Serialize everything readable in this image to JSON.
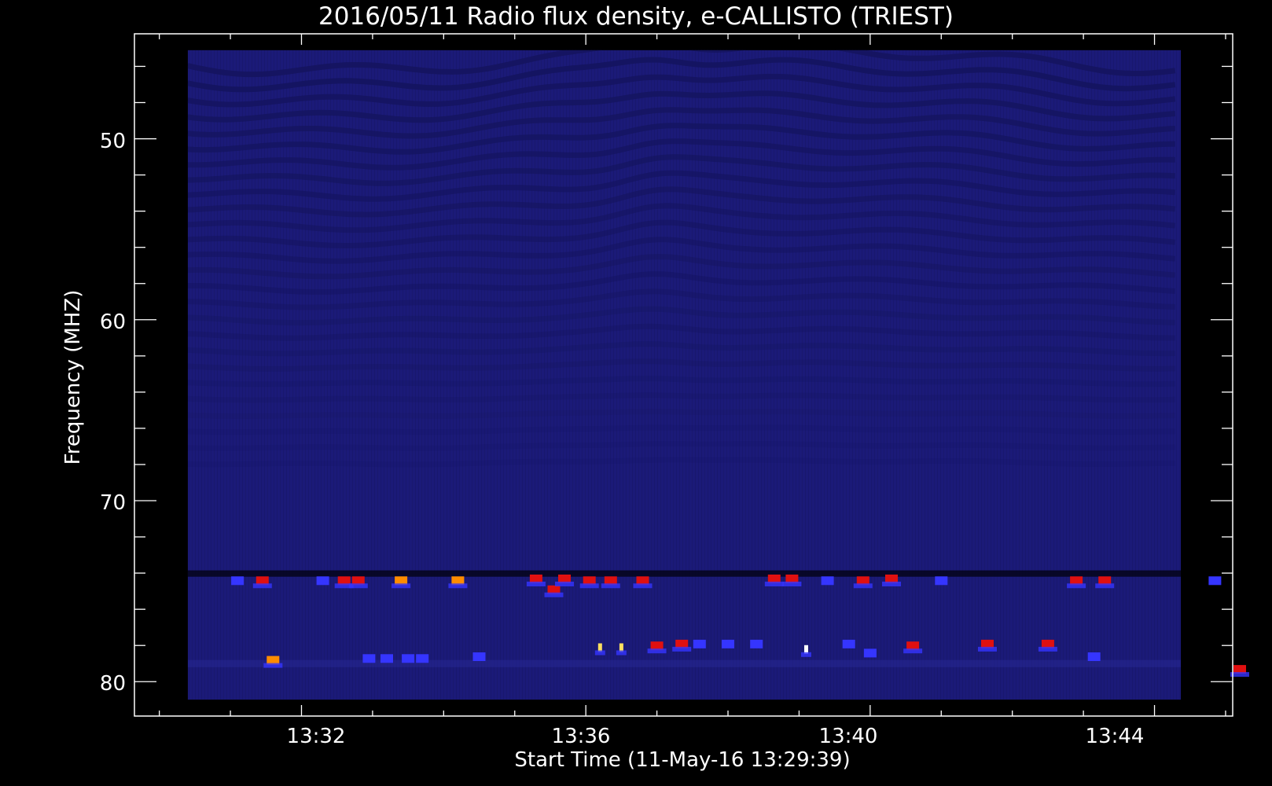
{
  "chart_data": {
    "type": "heatmap",
    "title": "2016/05/11  Radio flux density, e-CALLISTO (TRIEST)",
    "xlabel": "Start Time (11-May-16 13:29:39)",
    "ylabel": "Frequency (MHZ)",
    "x_ticks": [
      "13:32",
      "13:36",
      "13:40",
      "13:44"
    ],
    "x_tick_minutes": [
      32,
      36,
      40,
      44
    ],
    "y_ticks": [
      50,
      60,
      70,
      80
    ],
    "y_reversed": true,
    "xlim_minutes": [
      29.65,
      45.1
    ],
    "data_x_range_minutes": [
      30.4,
      45.45
    ],
    "ylim": [
      44.2,
      81.9
    ],
    "data_y_range": [
      45.1,
      81.0
    ],
    "colors": {
      "background": "#000000",
      "base": "#1b1a78",
      "dark_stripe": "#101050",
      "blue": "#3535ff",
      "red": "#e01010",
      "orange": "#ff8c00",
      "yellow": "#ffe060",
      "white": "#ffffff"
    },
    "bursts": [
      {
        "t": 31.1,
        "f": 74.4,
        "c": "blue"
      },
      {
        "t": 31.45,
        "f": 74.4,
        "c": "red"
      },
      {
        "t": 31.6,
        "f": 78.8,
        "c": "orange"
      },
      {
        "t": 32.3,
        "f": 74.4,
        "c": "blue"
      },
      {
        "t": 32.6,
        "f": 74.4,
        "c": "red"
      },
      {
        "t": 32.8,
        "f": 74.4,
        "c": "red"
      },
      {
        "t": 32.95,
        "f": 78.7,
        "c": "blue"
      },
      {
        "t": 33.2,
        "f": 78.7,
        "c": "blue"
      },
      {
        "t": 33.4,
        "f": 74.4,
        "c": "orange"
      },
      {
        "t": 33.5,
        "f": 78.7,
        "c": "blue"
      },
      {
        "t": 33.7,
        "f": 78.7,
        "c": "blue"
      },
      {
        "t": 34.2,
        "f": 74.4,
        "c": "orange"
      },
      {
        "t": 34.5,
        "f": 78.6,
        "c": "blue"
      },
      {
        "t": 35.3,
        "f": 74.3,
        "c": "red"
      },
      {
        "t": 35.55,
        "f": 74.9,
        "c": "red"
      },
      {
        "t": 35.7,
        "f": 74.3,
        "c": "red"
      },
      {
        "t": 36.05,
        "f": 74.4,
        "c": "red"
      },
      {
        "t": 36.2,
        "f": 78.1,
        "c": "yellow"
      },
      {
        "t": 36.35,
        "f": 74.4,
        "c": "red"
      },
      {
        "t": 36.5,
        "f": 78.1,
        "c": "yellow"
      },
      {
        "t": 36.8,
        "f": 74.4,
        "c": "red"
      },
      {
        "t": 37.0,
        "f": 78.0,
        "c": "red"
      },
      {
        "t": 37.35,
        "f": 77.9,
        "c": "red"
      },
      {
        "t": 37.6,
        "f": 77.9,
        "c": "blue"
      },
      {
        "t": 38.0,
        "f": 77.9,
        "c": "blue"
      },
      {
        "t": 38.4,
        "f": 77.9,
        "c": "blue"
      },
      {
        "t": 38.65,
        "f": 74.3,
        "c": "red"
      },
      {
        "t": 38.9,
        "f": 74.3,
        "c": "red"
      },
      {
        "t": 39.1,
        "f": 78.2,
        "c": "white"
      },
      {
        "t": 39.4,
        "f": 74.4,
        "c": "blue"
      },
      {
        "t": 39.7,
        "f": 77.9,
        "c": "blue"
      },
      {
        "t": 39.9,
        "f": 74.4,
        "c": "red"
      },
      {
        "t": 40.0,
        "f": 78.4,
        "c": "blue"
      },
      {
        "t": 40.3,
        "f": 74.3,
        "c": "red"
      },
      {
        "t": 40.6,
        "f": 78.0,
        "c": "red"
      },
      {
        "t": 41.0,
        "f": 74.4,
        "c": "blue"
      },
      {
        "t": 41.65,
        "f": 77.9,
        "c": "red"
      },
      {
        "t": 42.5,
        "f": 77.9,
        "c": "red"
      },
      {
        "t": 42.9,
        "f": 74.4,
        "c": "red"
      },
      {
        "t": 43.15,
        "f": 78.6,
        "c": "blue"
      },
      {
        "t": 43.3,
        "f": 74.4,
        "c": "red"
      },
      {
        "t": 44.85,
        "f": 74.4,
        "c": "blue"
      },
      {
        "t": 45.2,
        "f": 79.3,
        "c": "red"
      }
    ]
  }
}
